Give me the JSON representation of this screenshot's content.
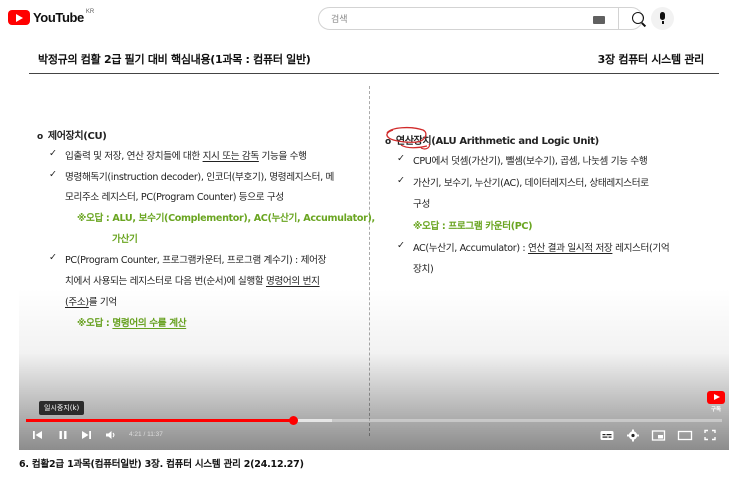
{
  "topbar": {
    "logo_text": "YouTube",
    "logo_country": "KR",
    "search_placeholder": "검색"
  },
  "slide": {
    "header_left": "박정규의 컴활 2급 필기 대비 핵심내용(1과목 : 컴퓨터 일반)",
    "header_right": "3장 컴퓨터 시스템 관리",
    "left": {
      "heading": "제어장치(CU)",
      "l1a": "입출력 및 저장, 연산 장치들에 대한 ",
      "l1b": "지시 또는 감독",
      "l1c": " 기능을 수행",
      "l2": "명령해독기(instruction decoder), 인코더(부호기), 명령레지스터, 메",
      "l2b": "모리주소 레지스터, PC(Program Counter) 등으로 구성",
      "wrong1": "※오답 : ALU, 보수기(Complementor), AC(누산기, Accumulator),",
      "wrong1b": "가산기",
      "l3": "PC(Program Counter, 프로그램카운터, 프로그램 계수기) : 제어장",
      "l3b_a": "치에서 사용되는 레지스터로 다음 번(순서)에 실행할 ",
      "l3b_b": "명령어의 번지",
      "l3c_a": "(주소)",
      "l3c_b": "를 기억",
      "wrong2a": "※오답 : ",
      "wrong2b": "명령어의 수를 계산"
    },
    "right": {
      "heading": "연산장치(ALU Arithmetic and Logic Unit)",
      "r1": "CPU에서 덧셈(가산기), 뺄셈(보수기), 곱셈, 나눗셈 기능 수행",
      "r2": "가산기, 보수기, 누산기(AC), 데이터레지스터, 상태레지스터로",
      "r2b": "구성",
      "wrong": "※오답 : 프로그램 카운터(PC)",
      "r3a": "AC(누산기, Accumulator) : ",
      "r3b": "연산 결과 일시적 저장",
      "r3c": " 레지스터(기억",
      "r3d": "장치)"
    }
  },
  "player": {
    "tooltip": "일시중지(k)",
    "time": "4:21 / 11:37",
    "progress": 0.385,
    "buffered": 0.44,
    "subscribe_label": "구독"
  },
  "video_title": "6. 컴활2급 1과목(컴퓨터일반) 3장. 컴퓨터 시스템 관리 2(24.12.27)"
}
